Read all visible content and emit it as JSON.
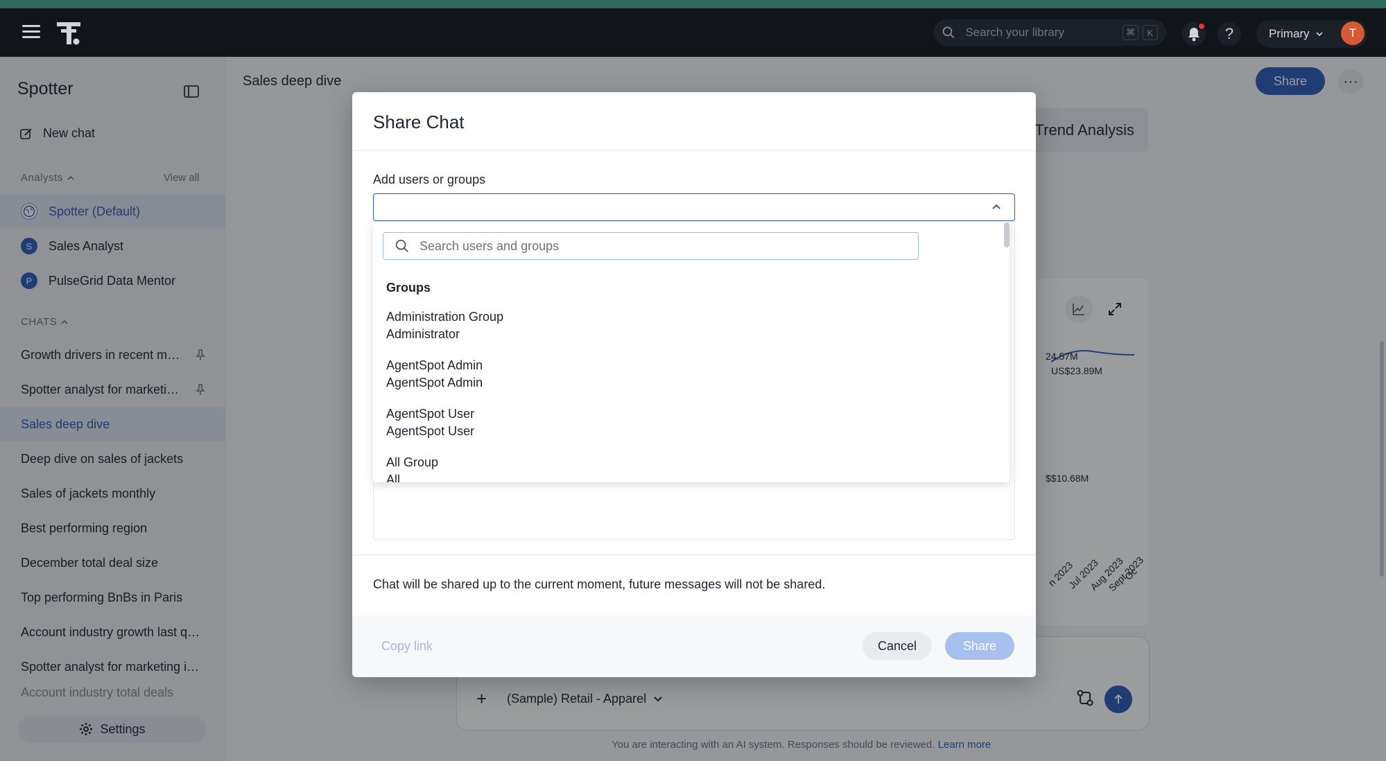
{
  "topbar": {
    "search_placeholder": "Search your library",
    "shortcut_keys": [
      "⌘",
      "K"
    ],
    "org_label": "Primary",
    "avatar_initial": "T",
    "help_label": "?"
  },
  "sidebar": {
    "title": "Spotter",
    "new_chat_label": "New chat",
    "analysts_header": "Analysts",
    "view_all_label": "View all",
    "analysts": [
      {
        "label": "Spotter (Default)",
        "badge": ""
      },
      {
        "label": "Sales Analyst",
        "badge": "S"
      },
      {
        "label": "PulseGrid Data Mentor",
        "badge": "P"
      }
    ],
    "chats_header": "CHATS",
    "chats": [
      {
        "label": "Growth drivers in recent months"
      },
      {
        "label": "Spotter analyst for marketing insights"
      },
      {
        "label": "Sales deep dive"
      },
      {
        "label": "Deep dive on sales of jackets"
      },
      {
        "label": "Sales of jackets monthly"
      },
      {
        "label": "Best performing region"
      },
      {
        "label": "December total deal size"
      },
      {
        "label": "Top performing BnBs in Paris"
      },
      {
        "label": "Account industry growth last quarter"
      },
      {
        "label": "Spotter analyst for marketing insights"
      },
      {
        "label": "Account industry total deals"
      }
    ],
    "settings_label": "Settings"
  },
  "main": {
    "title": "Sales deep dive",
    "share_label": "Share",
    "more_label": "⋯",
    "trend_label": "Trend Analysis",
    "chart_fragments": [
      "24.57M",
      "US$23.89M",
      "$$10.68M",
      "n 2023",
      "Jul 2023",
      "Aug 2023",
      "Sept 2023",
      "Oc"
    ],
    "datasource_label": "(Sample) Retail - Apparel",
    "disclaimer": "You are interacting with an AI system. Responses should be reviewed.",
    "learn_more_label": "Learn more"
  },
  "modal": {
    "title": "Share Chat",
    "field_label": "Add users or groups",
    "search_placeholder": "Search users and groups",
    "groups_header": "Groups",
    "options": [
      {
        "name": "Administration Group",
        "sub": "Administrator"
      },
      {
        "name": "AgentSpot Admin",
        "sub": "AgentSpot Admin"
      },
      {
        "name": "AgentSpot User",
        "sub": "AgentSpot User"
      },
      {
        "name": "All Group",
        "sub": "All"
      }
    ],
    "note": "Chat will be shared up to the current moment, future messages will not be shared.",
    "copy_link_label": "Copy link",
    "cancel_label": "Cancel",
    "share_label": "Share"
  },
  "colors": {
    "accent": "#2b5bb8",
    "notification": "#e3323b",
    "avatar": "#d65a36"
  }
}
